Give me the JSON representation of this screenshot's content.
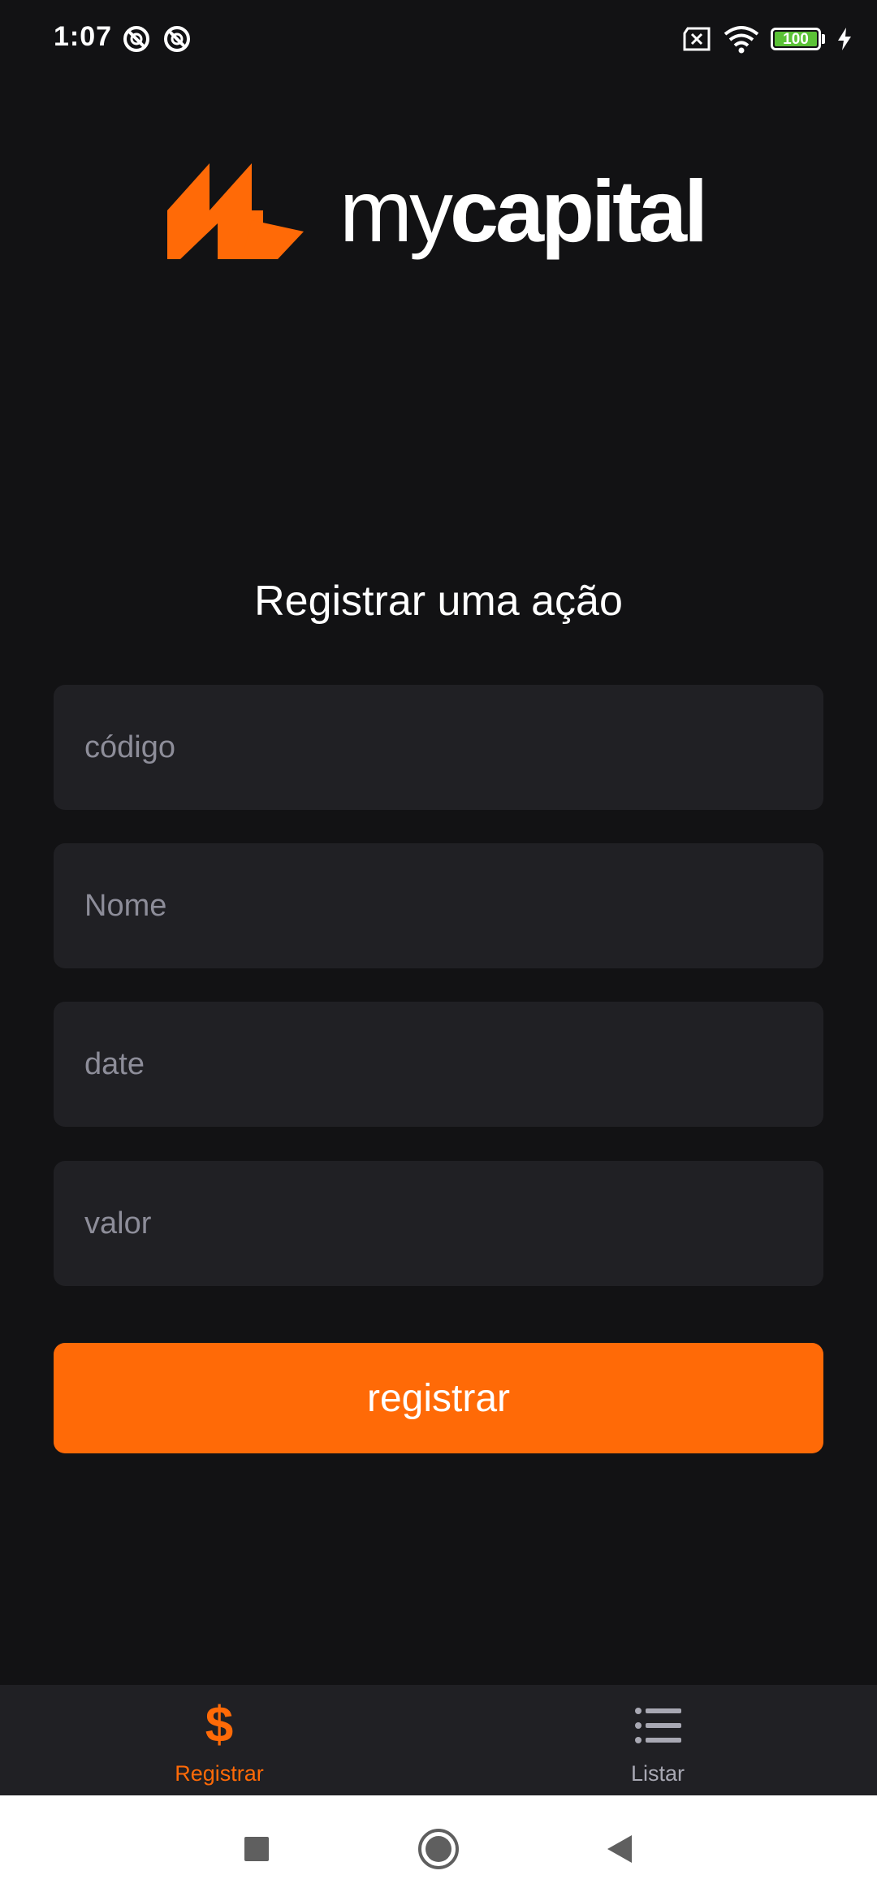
{
  "status_bar": {
    "time": "1:07",
    "battery_level": "100",
    "icons": [
      "notification-blocked-icon",
      "notification-blocked-icon",
      "sim-error-icon",
      "wifi-icon",
      "battery-icon",
      "charging-icon"
    ]
  },
  "brand": {
    "name_light": "my",
    "name_bold": "capital",
    "accent_color": "#ff6a07"
  },
  "form": {
    "title": "Registrar uma ação",
    "fields": {
      "codigo": {
        "placeholder": "código",
        "value": ""
      },
      "nome": {
        "placeholder": "Nome",
        "value": ""
      },
      "date": {
        "placeholder": "date",
        "value": ""
      },
      "valor": {
        "placeholder": "valor",
        "value": ""
      }
    },
    "submit_label": "registrar"
  },
  "tabs": {
    "registrar": {
      "label": "Registrar",
      "icon": "dollar-icon",
      "active": true
    },
    "listar": {
      "label": "Listar",
      "icon": "list-icon",
      "active": false
    }
  },
  "system_nav": {
    "buttons": [
      "recents-icon",
      "home-icon",
      "back-icon"
    ]
  },
  "colors": {
    "background": "#121214",
    "field_background": "#202024",
    "placeholder": "#8d8d99",
    "inactive_tab": "#a8a8b3"
  }
}
